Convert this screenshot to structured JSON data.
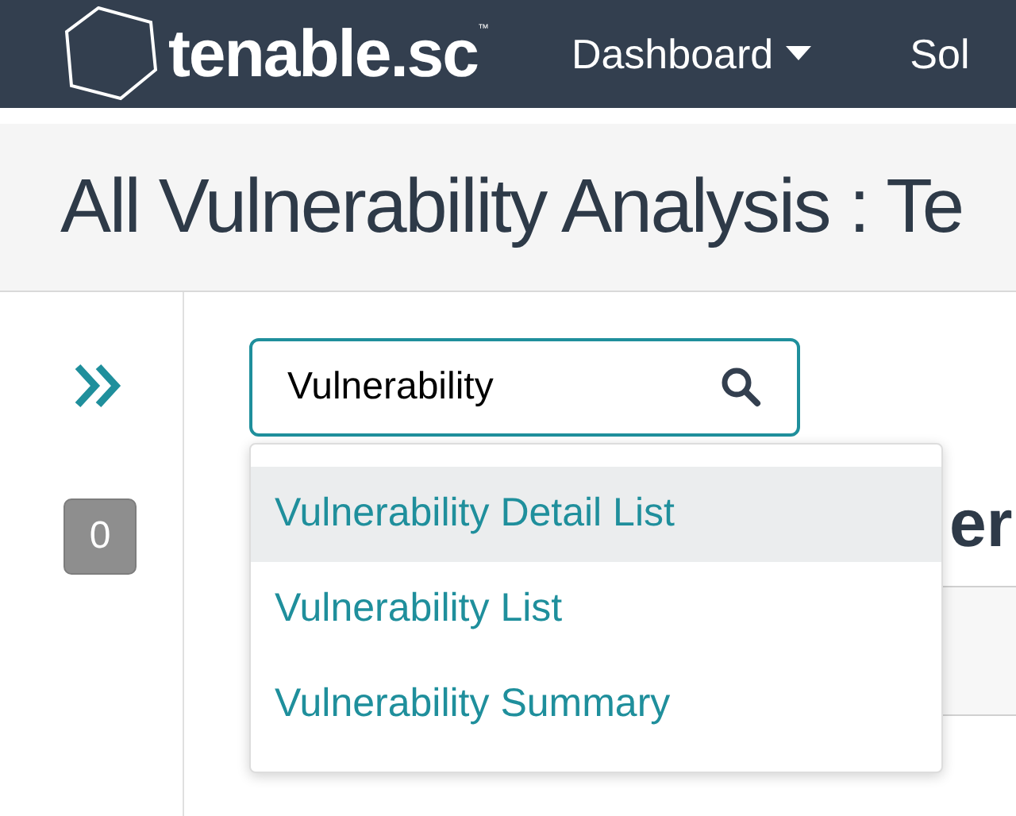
{
  "navbar": {
    "logo_text": "tenable.sc",
    "trademark": "™",
    "menu": [
      {
        "label": "Dashboard",
        "has_caret": true
      },
      {
        "label": "Sol",
        "has_caret": false
      }
    ]
  },
  "page_title": "All Vulnerability Analysis : Te",
  "sidebar": {
    "badge": "0"
  },
  "search": {
    "value": "Vulnerability"
  },
  "suggestions": [
    {
      "label": "Vulnerability Detail List",
      "selected": true
    },
    {
      "label": "Vulnerability List",
      "selected": false
    },
    {
      "label": "Vulnerability Summary",
      "selected": false
    }
  ],
  "heading_fragment": "er"
}
